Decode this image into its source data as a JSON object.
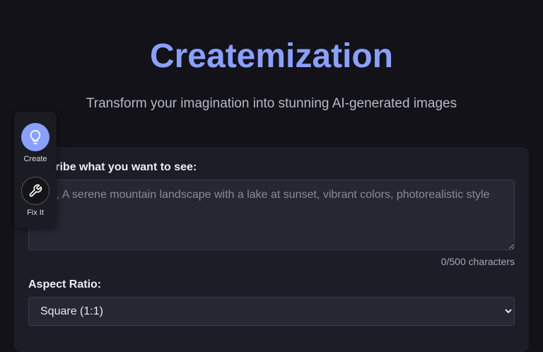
{
  "header": {
    "title": "Createmization",
    "subtitle": "Transform your imagination into stunning AI-generated images"
  },
  "form": {
    "prompt_label": "Describe what you want to see:",
    "prompt_placeholder": "e.g., A serene mountain landscape with a lake at sunset, vibrant colors, photorealistic style",
    "prompt_value": "",
    "char_count": "0/500 characters",
    "aspect_label": "Aspect Ratio:",
    "aspect_selected": "Square (1:1)"
  },
  "tools": {
    "items": [
      {
        "label": "Create",
        "icon": "lightbulb-icon",
        "active": true
      },
      {
        "label": "Fix It",
        "icon": "wrench-icon",
        "active": false
      }
    ]
  },
  "colors": {
    "accent": "#8aa0ff",
    "background": "#121218",
    "card": "#1d1d27",
    "input": "#272733"
  }
}
